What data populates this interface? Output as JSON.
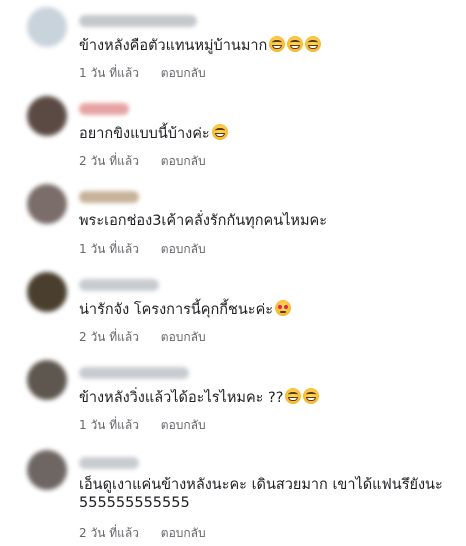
{
  "comments": [
    {
      "text": "ข้างหลังคือตัวแทนหมู่บ้านมาก",
      "emojis": [
        "laugh-cry",
        "laugh-cry",
        "laugh-cry"
      ],
      "time": "1 วัน ที่แล้ว",
      "reply": "ตอบกลับ",
      "avatar_color": "#c9d3dc",
      "name_color": "#c4c8cc"
    },
    {
      "text": "อยากขิงแบบนี้บ้างค่ะ",
      "emojis": [
        "laugh-cry"
      ],
      "time": "2 วัน ที่แล้ว",
      "reply": "ตอบกลับ",
      "avatar_color": "#5b4a44",
      "name_color": "#e6a3a3"
    },
    {
      "text": "พระเอกช่อง3เค้าคลั่งรักกันทุกคนไหมคะ",
      "emojis": [],
      "time": "1 วัน ที่แล้ว",
      "reply": "ตอบกลับ",
      "avatar_color": "#7a6d6a",
      "name_color": "#c7b29a"
    },
    {
      "text": "น่ารักจัง โครงการนี้คุกกี้ชนะค่ะ",
      "emojis": [
        "heart-eyes"
      ],
      "time": "2 วัน ที่แล้ว",
      "reply": "ตอบกลับ",
      "avatar_color": "#4a3f2e",
      "name_color": "#c8ccd0"
    },
    {
      "text": "ข้างหลังวิ่งแล้วได้อะไรไหมคะ ??",
      "emojis": [
        "grin-sweat",
        "grin-sweat"
      ],
      "time": "1 วัน ที่แล้ว",
      "reply": "ตอบกลับ",
      "avatar_color": "#5e574f",
      "name_color": "#c8ccd0"
    },
    {
      "text": "เอ็นดูเงาแค่นข้างหลังนะคะ เดินสวยมาก เขาได้แฟนรึยังนะ 555555555555",
      "emojis": [],
      "time": "2 วัน ที่แล้ว",
      "reply": "ตอบกลับ",
      "avatar_color": "#6e6663",
      "name_color": "#c8ccd0"
    }
  ]
}
